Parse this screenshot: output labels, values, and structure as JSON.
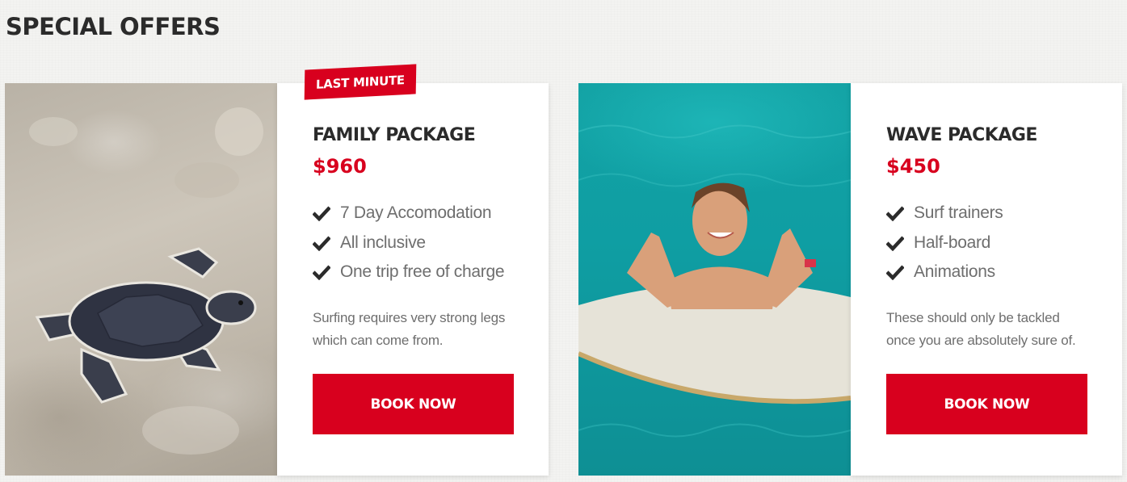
{
  "section": {
    "title": "SPECIAL OFFERS"
  },
  "offers": [
    {
      "badge": "LAST MINUTE",
      "title": "FAMILY PACKAGE",
      "price": "$960",
      "features": [
        "7 Day Accomodation",
        "All inclusive",
        "One trip free of charge"
      ],
      "description_line1": "Surfing requires very strong legs",
      "description_line2": "which can come from.",
      "button": "BOOK NOW",
      "image_subject": "baby-turtle-on-sand"
    },
    {
      "title": "WAVE PACKAGE",
      "price": "$450",
      "features": [
        "Surf trainers",
        "Half-board",
        "Animations"
      ],
      "description_line1": "These should only be tackled",
      "description_line2": "once you are absolutely sure of.",
      "button": "BOOK NOW",
      "image_subject": "woman-with-surfboard-in-pool"
    }
  ],
  "colors": {
    "accent": "#d8001e",
    "heading": "#2b2b2b",
    "text": "#6e6e6e",
    "card": "#ffffff"
  },
  "icons": {
    "feature": "check-icon"
  }
}
